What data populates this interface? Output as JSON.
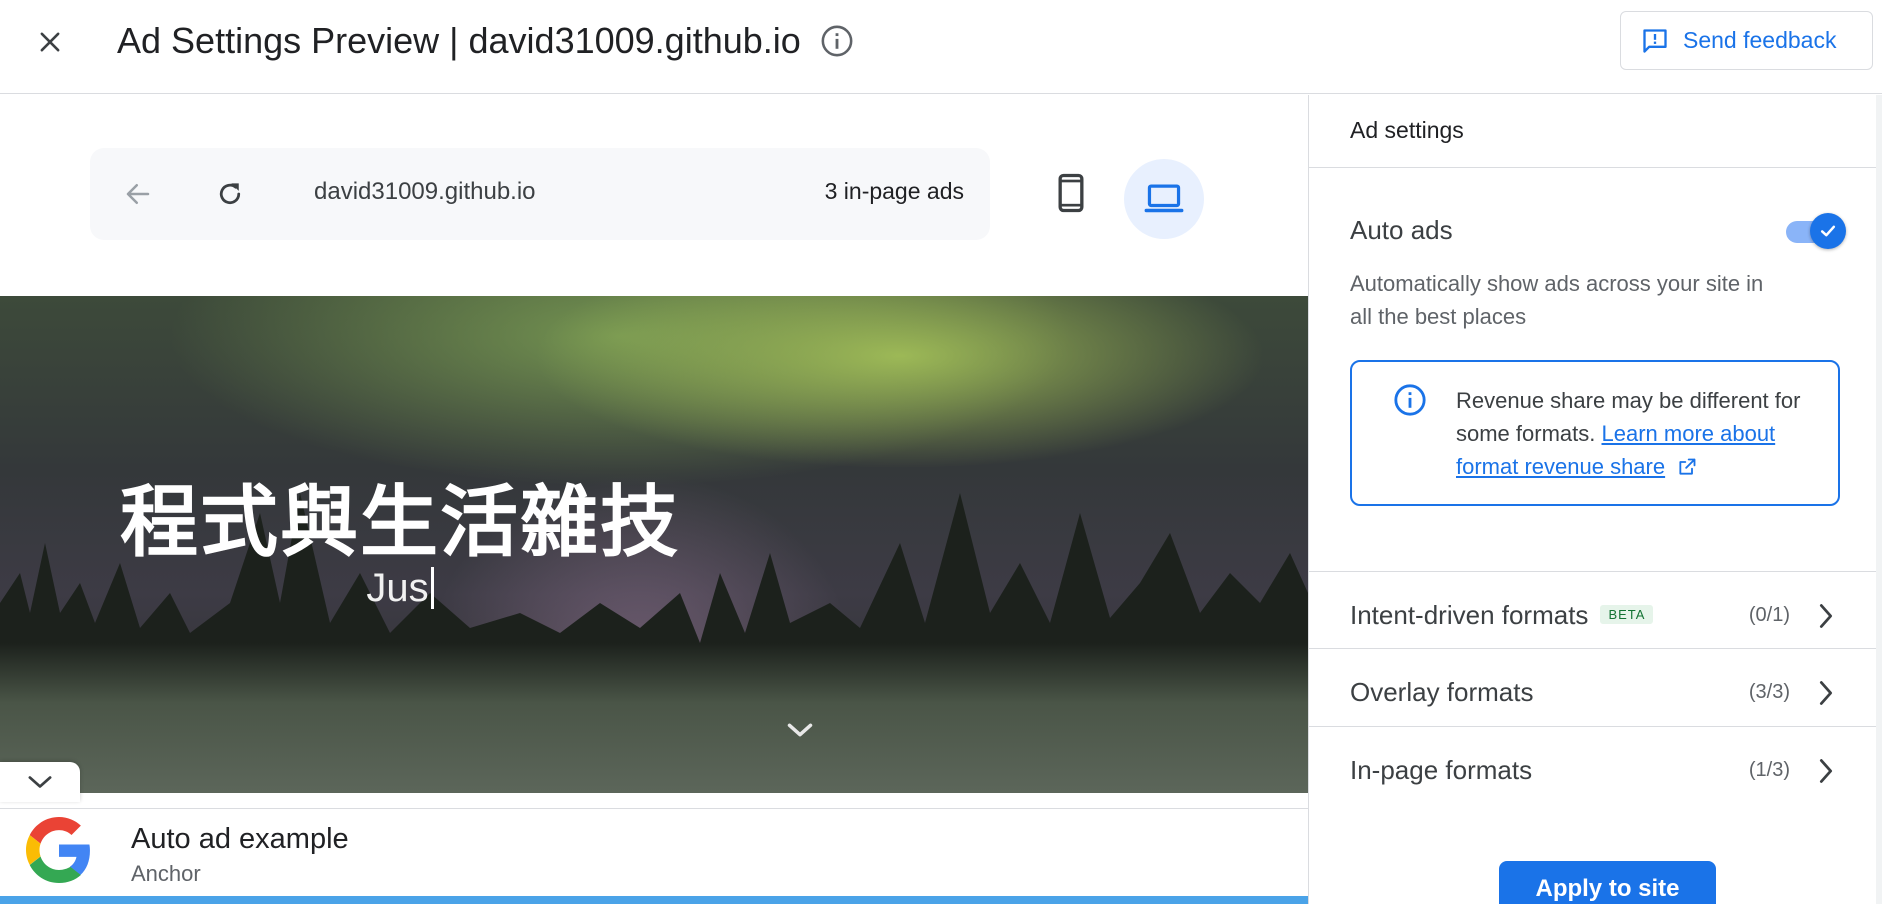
{
  "header": {
    "close_icon": "close-icon",
    "title": "Ad Settings Preview | david31009.github.io",
    "info_icon": "info-icon",
    "feedback_label": "Send feedback",
    "feedback_icon": "feedback-icon"
  },
  "preview": {
    "url": "david31009.github.io",
    "ad_count": "3 in-page ads",
    "back_icon": "arrow-back-icon",
    "reload_icon": "reload-icon",
    "mobile_icon": "smartphone-icon",
    "desktop_icon": "laptop-icon",
    "desktop_selected": true,
    "hero_title": "程式與生活雜技",
    "hero_subtitle": "Jus",
    "anchor_ad": {
      "title": "Auto ad example",
      "subtitle": "Anchor"
    }
  },
  "settings": {
    "header": "Ad settings",
    "auto_ads_label": "Auto ads",
    "auto_ads_enabled": true,
    "auto_ads_description": "Automatically show ads across your site in all the best places",
    "info_text": "Revenue share may be different for some formats.",
    "info_link": "Learn more about format revenue share",
    "formats": [
      {
        "label": "Intent-driven formats",
        "badge": "BETA",
        "count": "(0/1)"
      },
      {
        "label": "Overlay formats",
        "badge": "",
        "count": "(3/3)"
      },
      {
        "label": "In-page formats",
        "badge": "",
        "count": "(1/3)"
      }
    ],
    "apply_label": "Apply to site"
  },
  "colors": {
    "accent": "#1a73e8",
    "toggle_track": "#8ab4f8",
    "beta_bg": "#e6f4ea",
    "beta_text": "#137333"
  }
}
